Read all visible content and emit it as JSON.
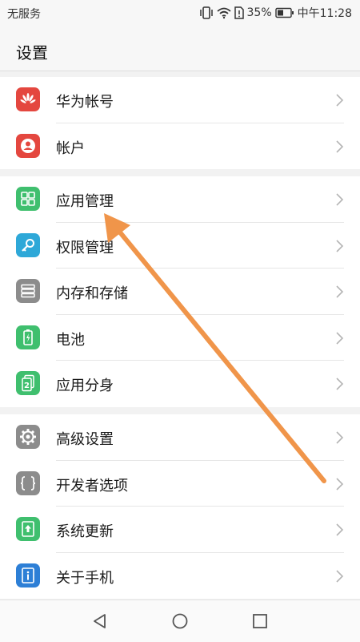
{
  "status": {
    "carrier": "无服务",
    "battery": "35%",
    "time": "中午11:28"
  },
  "header": {
    "title": "设置"
  },
  "groups": [
    {
      "items": [
        {
          "label": "华为帐号",
          "icon": "huawei-logo-icon",
          "color": "#e4473f"
        },
        {
          "label": "帐户",
          "icon": "user-icon",
          "color": "#e4473f"
        }
      ]
    },
    {
      "items": [
        {
          "label": "应用管理",
          "icon": "apps-grid-icon",
          "color": "#3fbf6e"
        },
        {
          "label": "权限管理",
          "icon": "key-icon",
          "color": "#2ea8d8"
        },
        {
          "label": "内存和存储",
          "icon": "storage-icon",
          "color": "#8c8c8c"
        },
        {
          "label": "电池",
          "icon": "battery-icon",
          "color": "#3fbf6e"
        },
        {
          "label": "应用分身",
          "icon": "app-twin-icon",
          "color": "#3fbf6e"
        }
      ]
    },
    {
      "items": [
        {
          "label": "高级设置",
          "icon": "gear-icon",
          "color": "#8c8c8c"
        },
        {
          "label": "开发者选项",
          "icon": "braces-icon",
          "color": "#8c8c8c"
        },
        {
          "label": "系统更新",
          "icon": "update-icon",
          "color": "#3fbf6e"
        },
        {
          "label": "关于手机",
          "icon": "info-icon",
          "color": "#2d7fd6"
        }
      ]
    }
  ],
  "annotation": {
    "arrow_color": "#f0954a"
  }
}
